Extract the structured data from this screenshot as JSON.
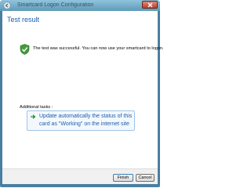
{
  "window": {
    "title": "Smartcard Logon Configuration"
  },
  "page": {
    "heading": "Test result",
    "success_message": "The test was successful. You can now use your smartcard to logon.",
    "additional_tasks_label": "Additional tasks :",
    "task_link_text": "Update automatically the status of this card as \"Working\" on the internet site"
  },
  "buttons": {
    "finish": "Finish",
    "cancel": "Cancel"
  },
  "icons": {
    "success": "green-shield-check-icon",
    "task": "green-arrow-icon",
    "back": "back-arrow-icon",
    "close": "close-icon"
  },
  "colors": {
    "heading": "#1b5fa8",
    "link": "#1b5fa8",
    "close_button": "#c0402a"
  }
}
